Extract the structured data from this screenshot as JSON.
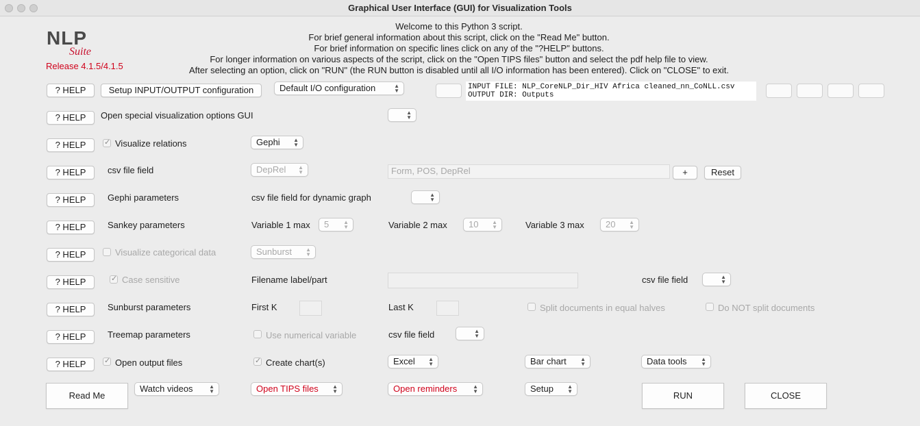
{
  "window": {
    "title": "Graphical User Interface (GUI) for Visualization Tools"
  },
  "logo": {
    "nlp": "NLP",
    "suite": "Suite",
    "release": "Release 4.1.5/4.1.5"
  },
  "welcome": [
    "Welcome to this Python 3 script.",
    "For brief general information about this script, click on the \"Read Me\" button.",
    "For brief information on specific lines click on any of the \"?HELP\" buttons.",
    "For longer information on various aspects of the script, click on the \"Open TIPS files\" button and select the pdf help file to view.",
    "After selecting an option, click on \"RUN\" (the RUN button is disabled until all I/O information has been entered).   Click on \"CLOSE\" to exit."
  ],
  "help_label": "? HELP",
  "io": {
    "setup_button": "Setup INPUT/OUTPUT configuration",
    "config_select": "Default I/O configuration",
    "input_file": "INPUT FILE: NLP_CoreNLP_Dir_HIV Africa cleaned_nn_CoNLL.csv",
    "output_dir": "OUTPUT DIR: Outputs"
  },
  "rows": {
    "special_gui": {
      "label": "Open special visualization options GUI",
      "select": ""
    },
    "visualize_relations": {
      "label": "Visualize relations",
      "checked": true,
      "select": "Gephi"
    },
    "csv_field": {
      "label": "csv file field",
      "select": "DepRel",
      "entry": "Form, POS, DepRel",
      "plus": "+",
      "reset": "Reset"
    },
    "gephi": {
      "label": "Gephi parameters",
      "dynamic_label": "csv file field for dynamic graph",
      "select": ""
    },
    "sankey": {
      "label": "Sankey parameters",
      "v1_label": "Variable 1 max",
      "v1": "5",
      "v2_label": "Variable 2 max",
      "v2": "10",
      "v3_label": "Variable 3 max",
      "v3": "20"
    },
    "categorical": {
      "label": "Visualize categorical data",
      "checked": false,
      "select": "Sunburst"
    },
    "case": {
      "label": "Case sensitive",
      "checked": true,
      "filename_label": "Filename label/part",
      "csv_label": "csv file field",
      "csv_select": ""
    },
    "sunburst": {
      "label": "Sunburst parameters",
      "first_k": "First K",
      "last_k": "Last K",
      "split_halves": "Split documents in equal halves",
      "no_split": "Do NOT split documents"
    },
    "treemap": {
      "label": "Treemap parameters",
      "numerical": "Use numerical variable",
      "csv_label": "csv file field",
      "csv_select": ""
    },
    "output": {
      "label": "Open output files",
      "checked": true,
      "charts_label": "Create chart(s)",
      "charts_checked": true,
      "excel": "Excel",
      "chart_type": "Bar chart",
      "data_tools": "Data tools"
    }
  },
  "bottom": {
    "read_me": "Read Me",
    "videos": "Watch videos",
    "tips": "Open TIPS files",
    "reminders": "Open reminders",
    "setup": "Setup",
    "run": "RUN",
    "close": "CLOSE"
  },
  "colors": {
    "release": "#d0021b",
    "tips": "#d0021b",
    "background": "#ececec"
  }
}
